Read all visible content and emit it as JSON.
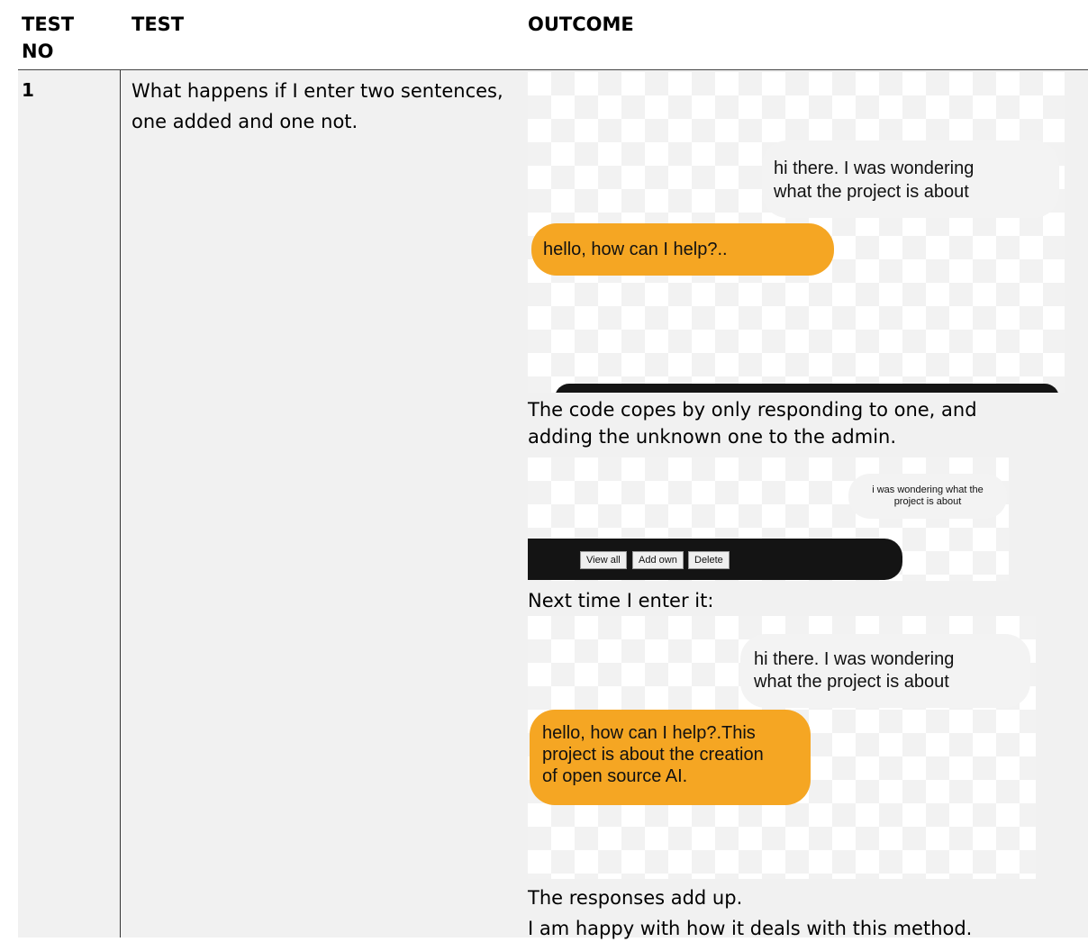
{
  "headers": {
    "test_no_line1": "TEST",
    "test_no_line2": "NO",
    "test": "TEST",
    "outcome": "OUTCOME"
  },
  "row": {
    "number": "1",
    "test_text": "What happens if I enter two sentences, one added and one not.",
    "outcome_para1_line1": "The code copes by only responding to one, and",
    "outcome_para1_line2": "adding the unknown one to the admin.",
    "outcome_para2": "Next time I enter it:",
    "outcome_para3": "The responses add up.",
    "outcome_para4": "I am happy with how it deals with this method."
  },
  "screenshot1": {
    "user_line1": "hi there. I was wondering",
    "user_line2": "what the project is about",
    "bot_message": "hello, how can I help?.."
  },
  "screenshot2": {
    "user_line1": "i was wondering what the",
    "user_line2": "project is about",
    "buttons": [
      "View all",
      "Add own",
      "Delete"
    ]
  },
  "screenshot3": {
    "user_line1": "hi there. I was wondering",
    "user_line2": "what the project is about",
    "bot_line1": "hello, how can I help?.This",
    "bot_line2": "project is about the creation",
    "bot_line3": "of open source AI."
  },
  "colors": {
    "bot_bubble": "#f5a623",
    "user_bubble": "#f3f3f3",
    "admin_bar": "#141414",
    "row_background": "#f1f1f1"
  }
}
